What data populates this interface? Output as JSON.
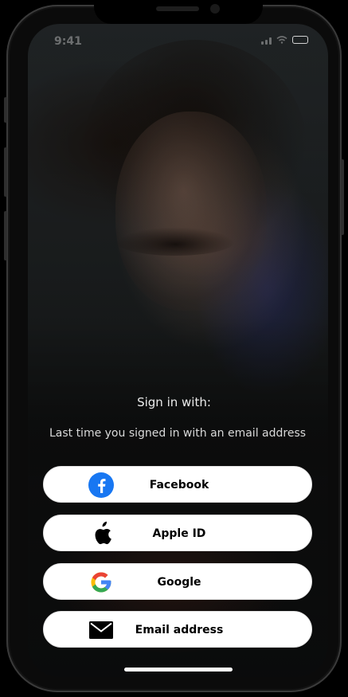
{
  "status_bar": {
    "time": "9:41"
  },
  "sign_in": {
    "heading": "Sign in with:",
    "subheading": "Last time you signed in with an email address"
  },
  "buttons": [
    {
      "label": "Facebook",
      "icon": "facebook-icon"
    },
    {
      "label": "Apple ID",
      "icon": "apple-icon"
    },
    {
      "label": "Google",
      "icon": "google-icon"
    },
    {
      "label": "Email address",
      "icon": "mail-icon"
    }
  ],
  "colors": {
    "button_background": "#ffffff",
    "button_text": "#000000",
    "facebook_blue": "#1877f2",
    "google_blue": "#4285f4",
    "google_red": "#ea4335",
    "google_yellow": "#fbbc05",
    "google_green": "#34a853"
  }
}
